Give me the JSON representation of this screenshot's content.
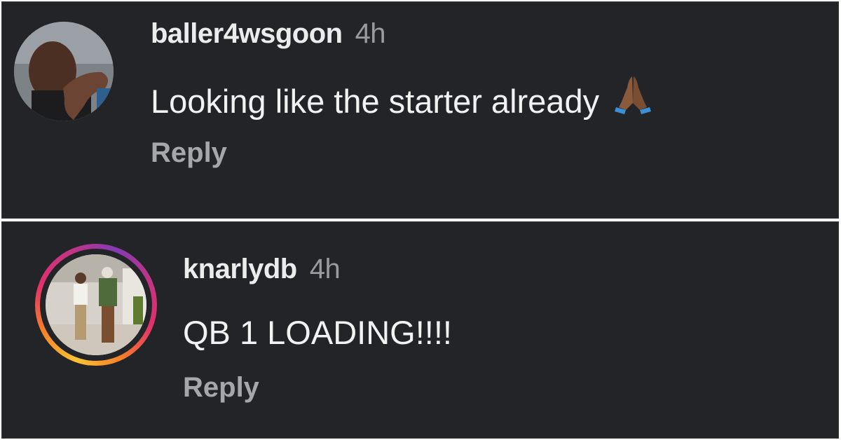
{
  "comments": [
    {
      "username": "baller4wsgoon",
      "time": "4h",
      "text": "Looking like the starter already",
      "emoji": "folded-hands",
      "reply_label": "Reply",
      "avatar_ring": false
    },
    {
      "username": "knarlydb",
      "time": "4h",
      "text": "QB 1 LOADING!!!!",
      "reply_label": "Reply",
      "avatar_ring": true
    }
  ],
  "colors": {
    "background": "#232428",
    "username": "#ececec",
    "timestamp": "#9a9ba0",
    "comment_text": "#f2f2f2",
    "reply": "#a6a7ac",
    "story_ring_gradient": [
      "#f9c433",
      "#f77f2a",
      "#e1306c",
      "#c13584",
      "#833ab4"
    ]
  }
}
